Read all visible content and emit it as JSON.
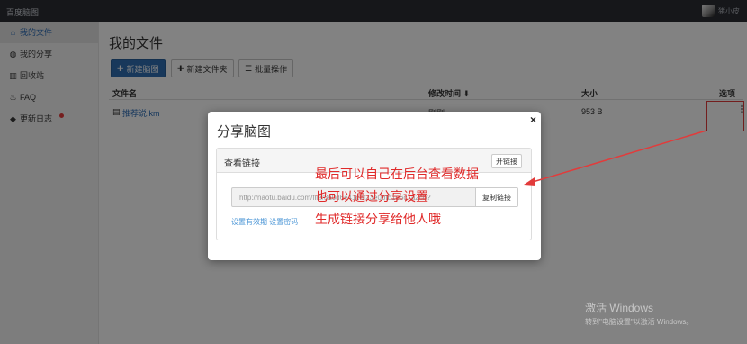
{
  "app": {
    "brand": "百度脑图",
    "user_name": "猪小皮"
  },
  "sidebar": {
    "items": [
      {
        "label": "我的文件",
        "icon": "home-icon"
      },
      {
        "label": "我的分享",
        "icon": "globe-icon"
      },
      {
        "label": "回收站",
        "icon": "trash-icon"
      },
      {
        "label": "FAQ",
        "icon": "fire-icon"
      },
      {
        "label": "更新日志",
        "icon": "tag-icon"
      }
    ]
  },
  "main": {
    "title": "我的文件",
    "toolbar": {
      "new_mindmap": "新建脑图",
      "new_folder": "新建文件夹",
      "batch": "批量操作"
    },
    "table": {
      "headers": {
        "name": "文件名",
        "modified": "修改时间 ⬇",
        "size": "大小",
        "options": "选项"
      },
      "rows": [
        {
          "name": "推荐说.km",
          "modified": "刚刚",
          "size": "953 B"
        }
      ]
    }
  },
  "modal": {
    "title": "分享脑图",
    "close": "×",
    "panel_title": "查看链接",
    "panel_button": "开链接",
    "link_value": "http://naotu.baidu.com/file/3a0d6e41c8f23e0bfb1e6c7a2cb?",
    "copy_label": "复制链接",
    "set_expiry": "设置有效期",
    "set_password": "设置密码"
  },
  "annotation": {
    "lines": [
      "最后可以自己在后台查看数据",
      "也可以通过分享设置",
      "生成链接分享给他人哦"
    ],
    "color": "#e02a2a"
  },
  "watermark": {
    "title": "激活 Windows",
    "subtitle": "转到\"电脑设置\"以激活 Windows。"
  }
}
